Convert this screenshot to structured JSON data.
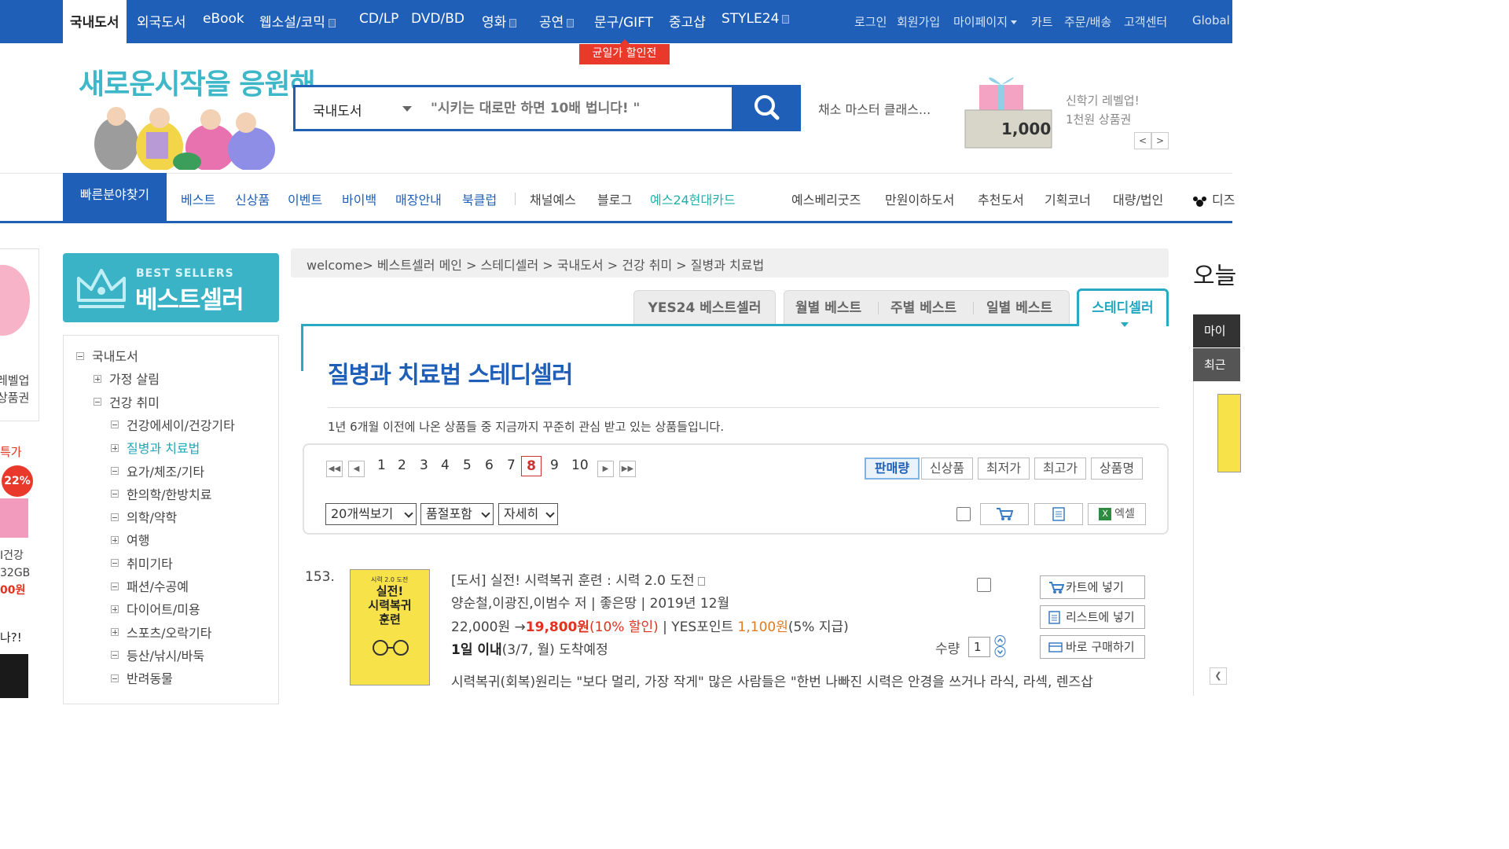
{
  "gnb": {
    "items": [
      "국내도서",
      "외국도서",
      "eBook",
      "웹소설/코믹",
      "CD/LP",
      "DVD/BD",
      "영화",
      "공연",
      "문구/GIFT",
      "중고샵",
      "STYLE24"
    ],
    "util": [
      "로그인",
      "회원가입",
      "마이페이지",
      "카트",
      "주문/배송",
      "고객센터",
      "Global"
    ],
    "badge": "균일가 할인전"
  },
  "header": {
    "logo_text": "새로운시작을 응원해",
    "search_category": "국내도서",
    "search_placeholder": "\"시키는 대로만 하면 10배 법니다! \"",
    "recommend": "채소 마스터 클래스...",
    "voucher_amount": "1,000",
    "promo_line1": "신학기 레벨업!",
    "promo_line2": "1천원 상품권",
    "prev_label": "<",
    "next_label": ">"
  },
  "catnav": {
    "quick": "빠른분야찾기",
    "blue_items": [
      "베스트",
      "신상품",
      "이벤트",
      "바이백",
      "매장안내",
      "북클럽"
    ],
    "gray_items": [
      "채널예스",
      "블로그"
    ],
    "green_item": "예스24현대카드",
    "right_items": [
      "예스베리굿즈",
      "만원이하도서",
      "추천도서",
      "기획코너",
      "대량/법인",
      "디즈"
    ]
  },
  "sidebar": {
    "banner_small": "BEST SELLERS",
    "banner_big": "베스트셀러",
    "tree": [
      {
        "label": "국내도서",
        "type": "minus",
        "level": 0
      },
      {
        "label": "가정 살림",
        "type": "plus",
        "level": 1
      },
      {
        "label": "건강 취미",
        "type": "minus",
        "level": 1
      },
      {
        "label": "건강에세이/건강기타",
        "type": "minus",
        "level": 2
      },
      {
        "label": "질병과 치료법",
        "type": "plus",
        "level": 2,
        "active": true
      },
      {
        "label": "요가/체조/기타",
        "type": "minus",
        "level": 2
      },
      {
        "label": "한의학/한방치료",
        "type": "minus",
        "level": 2
      },
      {
        "label": "의학/약학",
        "type": "minus",
        "level": 2
      },
      {
        "label": "여행",
        "type": "plus",
        "level": 2
      },
      {
        "label": "취미기타",
        "type": "minus",
        "level": 2
      },
      {
        "label": "패션/수공예",
        "type": "minus",
        "level": 2
      },
      {
        "label": "다이어트/미용",
        "type": "plus",
        "level": 2
      },
      {
        "label": "스포츠/오락기타",
        "type": "plus",
        "level": 2
      },
      {
        "label": "등산/낚시/바둑",
        "type": "minus",
        "level": 2
      },
      {
        "label": "반려동물",
        "type": "minus",
        "level": 2
      }
    ],
    "edge_texts": [
      "레벨업",
      "상품권",
      "특가",
      "22%",
      "I건강",
      "32GB",
      "00원",
      "나?!"
    ]
  },
  "breadcrumb": "welcome> 베스트셀러 메인 > 스테디셀러 > 국내도서 > 건강 취미 > 질병과 치료법",
  "tabs": [
    "YES24 베스트셀러",
    "월별 베스트",
    "주별 베스트",
    "일별 베스트",
    "스테디셀러"
  ],
  "page_title": "질병과 치료법 스테디셀러",
  "description": "1년 6개월 이전에 나온 상품들 중 지금까지 꾸준히 관심 받고 있는 상품들입니다.",
  "pagination": {
    "pages": [
      "1",
      "2",
      "3",
      "4",
      "5",
      "6",
      "7",
      "8",
      "9",
      "10"
    ],
    "current": "8"
  },
  "sort": [
    "판매량",
    "신상품",
    "최저가",
    "최고가",
    "상품명"
  ],
  "filters": [
    "20개씩보기",
    "품절포함",
    "자세히"
  ],
  "tools": {
    "excel": "엑셀"
  },
  "product": {
    "rank": "153.",
    "title": "[도서] 실전! 시력복귀 훈련 : 시력 2.0 도전",
    "author_line": "양순철,이광진,이범수 저 | 좋은땅 | 2019년 12월",
    "price_orig": "22,000원",
    "arrow": "→",
    "price_sale": "19,800원",
    "discount": "(10% 할인)",
    "points_label": "| YES포인트",
    "points": "1,100원",
    "points_rate": "(5% 지급)",
    "delivery_bold": "1일 이내",
    "delivery_rest": "(3/7, 월) 도착예정",
    "summary": "시력복귀(회복)원리는 \"보다 멀리, 가장 작게\" 많은 사람들은 \"한번 나빠진 시력은 안경을 쓰거나 라식, 라섹, 렌즈삽",
    "cover_top": "시력 2.0 도전",
    "cover_title": "실전!\n시력복귀\n훈련",
    "qty_label": "수량",
    "qty": "1",
    "buttons": [
      "카트에 넣기",
      "리스트에 넣기",
      "바로 구매하기"
    ]
  },
  "right_rail": {
    "title": "오늘",
    "item1": "마이",
    "item2": "최근"
  },
  "colors": {
    "brand_blue": "#1f5fb8",
    "teal": "#2aa9c2",
    "sale_red": "#e0331f"
  }
}
